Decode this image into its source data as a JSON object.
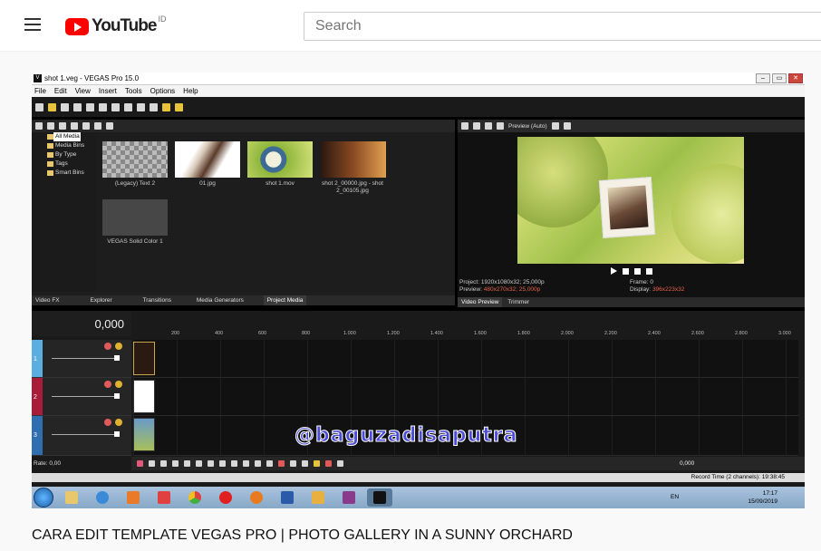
{
  "youtube": {
    "logo_text": "YouTube",
    "region": "ID",
    "search_placeholder": "Search",
    "video_title": "CARA EDIT TEMPLATE VEGAS PRO | PHOTO GALLERY IN A SUNNY ORCHARD"
  },
  "vegas": {
    "window_title": "shot 1.veg - VEGAS Pro 15.0",
    "menu": [
      "File",
      "Edit",
      "View",
      "Insert",
      "Tools",
      "Options",
      "Help"
    ],
    "tree": [
      "All Media",
      "Media Bins",
      "By Type",
      "Tags",
      "Smart Bins"
    ],
    "media": [
      {
        "label": "(Legacy) Text 2"
      },
      {
        "label": "01.jpg"
      },
      {
        "label": "shot 1.mov"
      },
      {
        "label": "shot 2_00000.jpg - shot 2_00105.jpg"
      },
      {
        "label": "VEGAS Solid Color 1"
      }
    ],
    "left_tabs": [
      "Video FX",
      "Explorer",
      "Transitions",
      "Media Generators",
      "Project Media"
    ],
    "preview_mode": "Preview (Auto)",
    "preview_tabs": [
      "Video Preview",
      "Trimmer"
    ],
    "project_info": "Project:   1920x1080x32; 25,000p",
    "preview_info_label": "Preview:",
    "preview_info_value": "480x270x32; 25,000p",
    "frame_info": "Frame:      0",
    "display_info_label": "Display:",
    "display_info_value": "396x223x32",
    "timecode": "0,000",
    "ruler": [
      "200",
      "400",
      "600",
      "800",
      "1.000",
      "1.200",
      "1.400",
      "1.600",
      "1.800",
      "2.000",
      "2.200",
      "2.400",
      "2.600",
      "2.800",
      "3.000"
    ],
    "tracks": [
      "1",
      "2",
      "3"
    ],
    "rate": "Rate: 0,00",
    "end_time": "0,000",
    "status": "Record Time (2 channels): 19:38:45",
    "watermark": "@baguzadisaputra"
  },
  "taskbar": {
    "lang": "EN",
    "time": "17:17",
    "date": "15/09/2019"
  }
}
